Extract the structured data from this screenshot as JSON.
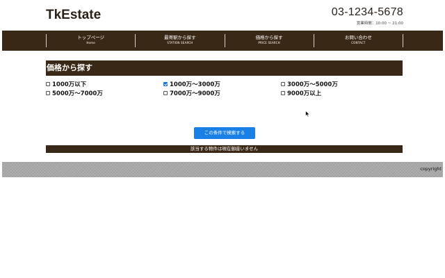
{
  "header": {
    "logo": "TkEstate",
    "phone": "03-1234-5678",
    "hours": "営業時間：10:00 ~ 21:00"
  },
  "nav": {
    "items": [
      {
        "label": "トップページ",
        "sub": "Home"
      },
      {
        "label": "最寄駅から探す",
        "sub": "STATION SEARCH"
      },
      {
        "label": "価格から探す",
        "sub": "PRICE SEARCH"
      },
      {
        "label": "お問い合わせ",
        "sub": "CONTACT"
      }
    ]
  },
  "section": {
    "title": "価格から探す"
  },
  "price_options": [
    {
      "label": "1000万以下",
      "checked": false
    },
    {
      "label": "1000万〜3000万",
      "checked": true
    },
    {
      "label": "3000万〜5000万",
      "checked": false
    },
    {
      "label": "5000万〜7000万",
      "checked": false
    },
    {
      "label": "7000万〜9000万",
      "checked": false
    },
    {
      "label": "9000万以上",
      "checked": false
    }
  ],
  "search": {
    "button_label": "この条件で検索する",
    "result_message": "該当する物件は現在御座いません"
  },
  "footer": {
    "copyright": "copyright"
  },
  "colors": {
    "brand_dark": "#3a2816",
    "button_blue": "#1a80e6",
    "footer_gray": "#a9a9a9"
  }
}
